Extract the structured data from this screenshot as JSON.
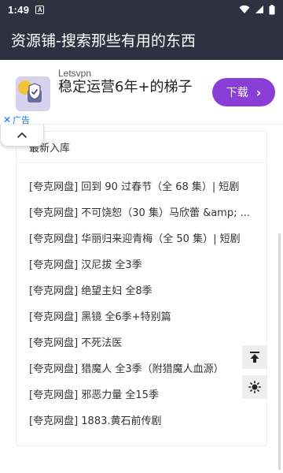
{
  "status_bar": {
    "time": "1:49",
    "notification_letter": "A"
  },
  "app_bar": {
    "title": "资源铺-搜索那些有用的东西"
  },
  "ad": {
    "brand": "Letsvpn",
    "title": "稳定运营6年+的梯子",
    "cta_label": "下载",
    "cta_arrow": "›",
    "close": "✕",
    "tag_label": "广告",
    "accent_color": "#8a3ed8"
  },
  "card": {
    "header": "最新入库",
    "items": [
      "[夸克网盘] 回到 90 过春节（全 68 集）| 短剧",
      "[夸克网盘] 不可饶恕（30 集）马欣蕾 &amp; ...",
      "[夸克网盘] 华丽归来迎青梅（全 50 集）| 短剧",
      "[夸克网盘] 汉尼拔 全3季",
      "[夸克网盘] 绝望主妇 全8季",
      "[夸克网盘] 黑镜 全6季+特别篇",
      "[夸克网盘] 不死法医",
      "[夸克网盘] 猎魔人 全3季（附猎魔人血源）",
      "[夸克网盘] 邪恶力量 全15季",
      "[夸克网盘] 1883.黄石前传剧"
    ]
  },
  "icons": {
    "collapse": "chevron-up-icon",
    "back_to_top": "back-to-top-icon",
    "theme": "brightness-icon"
  }
}
